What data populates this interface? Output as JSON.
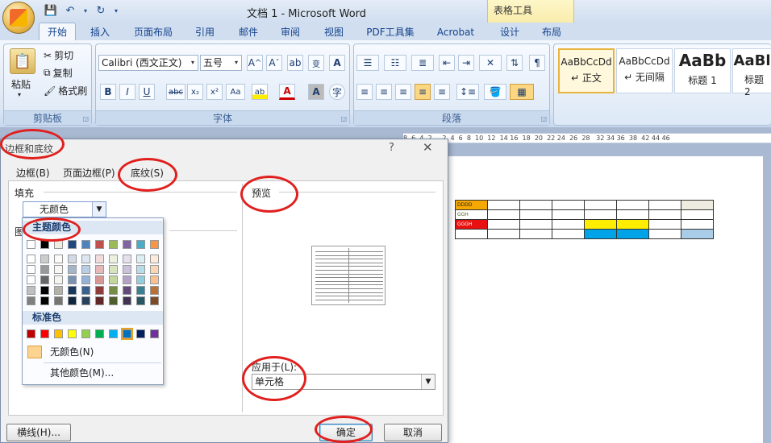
{
  "window": {
    "title": "文档 1 - Microsoft Word",
    "context_tab_group": "表格工具"
  },
  "tabs": [
    "开始",
    "插入",
    "页面布局",
    "引用",
    "邮件",
    "审阅",
    "视图",
    "PDF工具集",
    "Acrobat",
    "设计",
    "布局"
  ],
  "ribbon": {
    "clipboard": {
      "paste": "粘贴",
      "cut": "剪切",
      "copy": "复制",
      "format_painter": "格式刷",
      "label": "剪贴板"
    },
    "font": {
      "font_name": "Calibri (西文正文)",
      "font_size": "五号",
      "label": "字体"
    },
    "paragraph": {
      "label": "段落"
    },
    "styles": [
      {
        "sample": "AaBbCcDd",
        "name": "↵ 正文"
      },
      {
        "sample": "AaBbCcDd",
        "name": "↵ 无间隔"
      },
      {
        "sample": "AaBb",
        "name": "标题 1"
      },
      {
        "sample": "AaBl",
        "name": "标题 2"
      }
    ]
  },
  "ruler_text": "8  6  4  2     2  4  6  8  10  12  14 16  18  20  22 24  26  28   32 34 36  38  42 44 46",
  "document_table": {
    "rows": [
      [
        "DDDD",
        "",
        "",
        "",
        "",
        "",
        "",
        ""
      ],
      [
        "GGH",
        "",
        "",
        "",
        "",
        "",
        "",
        ""
      ],
      [
        "GGGH",
        "",
        "",
        "",
        "",
        "",
        "",
        ""
      ],
      [
        "",
        "",
        "",
        "",
        "",
        "",
        "",
        ""
      ]
    ],
    "colors": {
      "orange": "#f5a800",
      "red": "#e81010",
      "yellow": "#ffee00",
      "blue": "#00a2e8",
      "light_blue": "#a9cce9",
      "beige": "#eeece1",
      "green_text": "#4f6228"
    }
  },
  "dialog": {
    "title": "边框和底纹",
    "help": "?",
    "close": "✕",
    "tabs": [
      "边框(B)",
      "页面边框(P)",
      "底纹(S)"
    ],
    "fill_label": "填充",
    "fill_value": "无颜色",
    "pattern_label": "图",
    "preview_label": "预览",
    "apply_label": "应用于(L):",
    "apply_value": "单元格",
    "buttons": {
      "horizontal_line": "横线(H)...",
      "ok": "确定",
      "cancel": "取消"
    },
    "color_popup": {
      "theme_label": "主题颜色",
      "standard_label": "标准色",
      "no_color": "无颜色(N)",
      "more_colors": "其他颜色(M)...",
      "theme_top": [
        "#ffffff",
        "#000000",
        "#eeece1",
        "#1f497d",
        "#4f81bd",
        "#c0504d",
        "#9bbb59",
        "#8064a2",
        "#4bacc6",
        "#f79646"
      ],
      "standard": [
        "#c00000",
        "#ff0000",
        "#ffc000",
        "#ffff00",
        "#92d050",
        "#00b050",
        "#00b0f0",
        "#0070c0",
        "#002060",
        "#7030a0"
      ]
    }
  }
}
